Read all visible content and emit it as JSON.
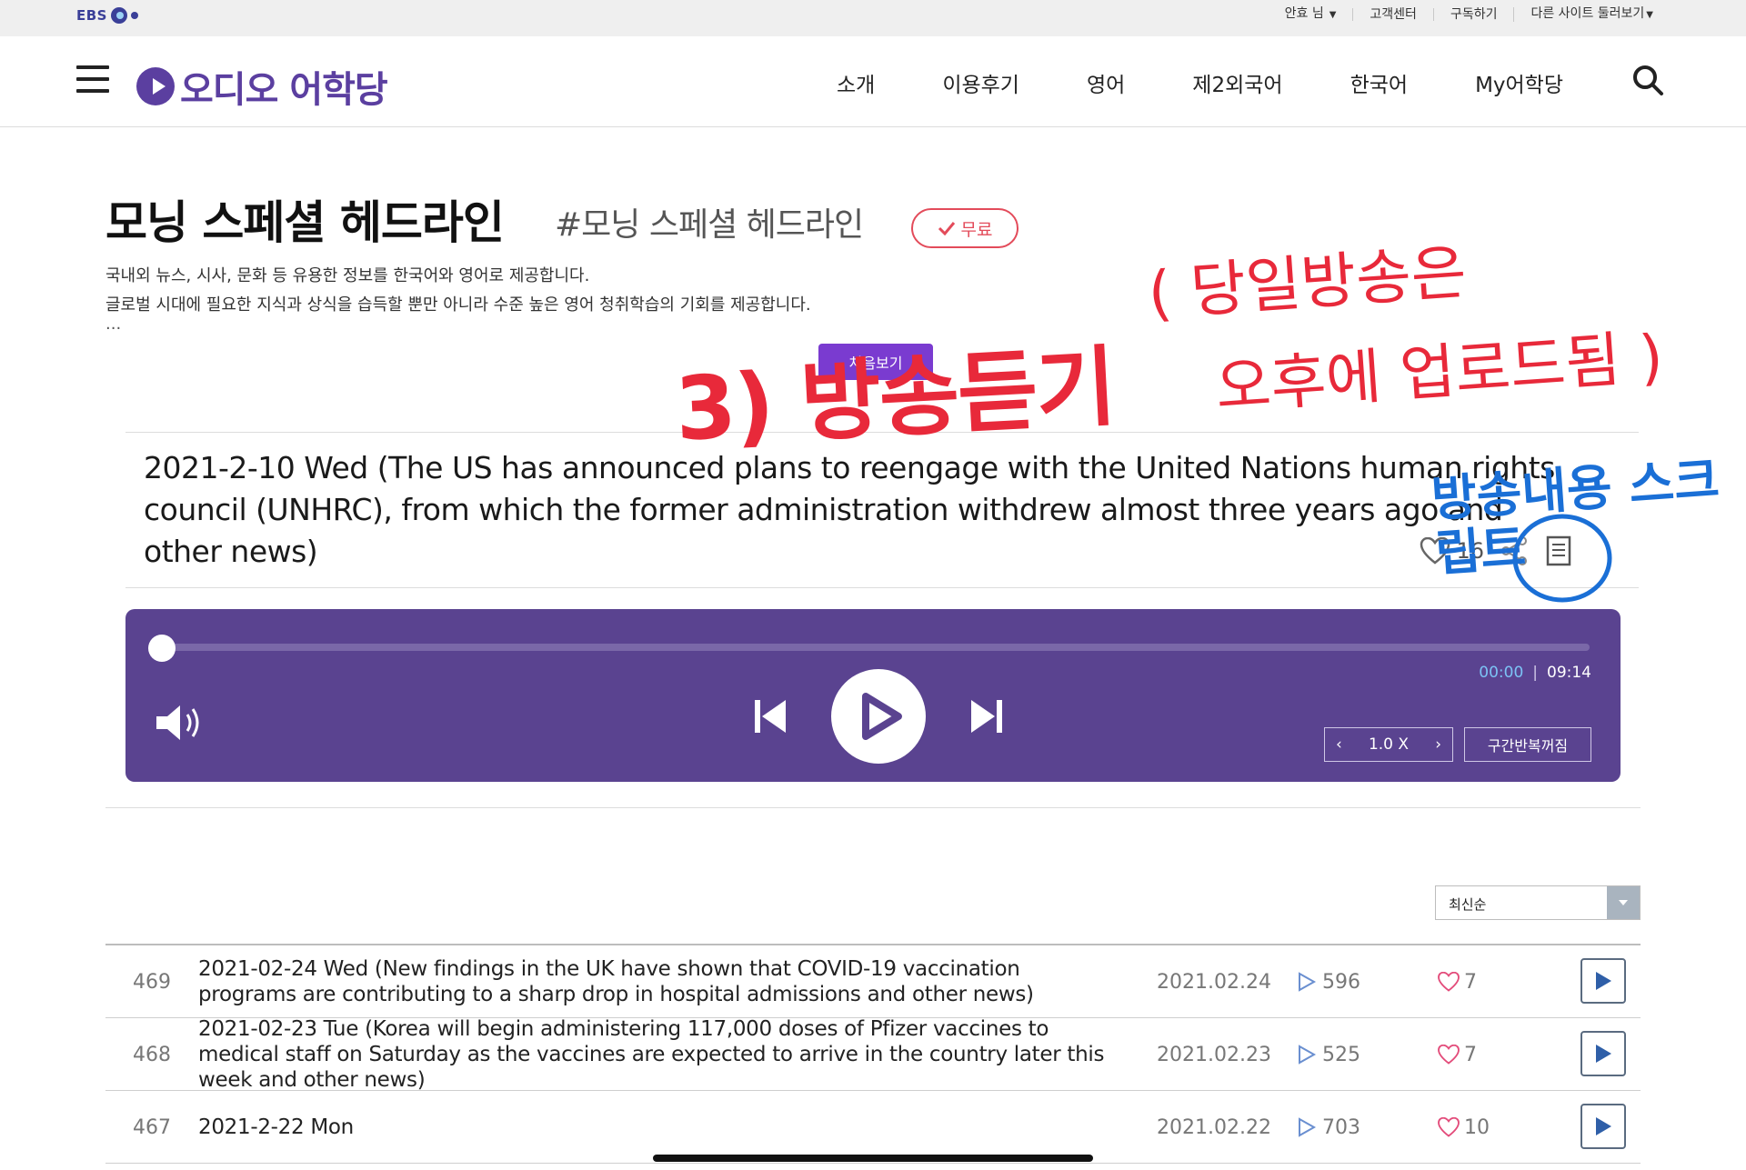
{
  "topbar": {
    "logo_text": "EBS",
    "links": [
      "안효 님",
      "고객센터",
      "구독하기",
      "다른 사이트 둘러보기"
    ]
  },
  "header": {
    "brand": "오디오 어학당",
    "nav": [
      "소개",
      "이용후기",
      "영어",
      "제2외국어",
      "한국어",
      "My어학당"
    ]
  },
  "program": {
    "title": "모닝 스페셜 헤드라인",
    "tag": "#모닝 스페셜 헤드라인",
    "badge": "무료",
    "desc_line1": "국내외 뉴스, 시사, 문화 등 유용한 정보를 한국어와 영어로 제공합니다.",
    "desc_line2": "글로벌 시대에 필요한 지식과 상식을 습득할 뿐만 아니라 수준 높은 영어 청취학습의 기회를 제공합니다.",
    "ellipsis": "...",
    "first_button": "처음보기"
  },
  "episode": {
    "title": "2021-2-10 Wed (The US has announced plans to reengage with the United Nations human rights council (UNHRC), from which the former administration withdrew almost three years ago and other news)",
    "likes": "16"
  },
  "player": {
    "progress": 0,
    "current_time": "00:00",
    "total_time": "09:14",
    "speed": "1.0 X",
    "repeat_label": "구간반복꺼짐"
  },
  "sort": {
    "selected": "최신순"
  },
  "list": [
    {
      "num": "469",
      "title": "2021-02-24 Wed (New findings in the UK have shown that COVID-19 vaccination programs are contributing to a sharp drop in hospital admissions and other news)",
      "date": "2021.02.24",
      "plays": "596",
      "likes": "7"
    },
    {
      "num": "468",
      "title": "2021-02-23 Tue (Korea will begin administering 117,000 doses of Pfizer vaccines to medical staff on Saturday as the vaccines are expected to arrive in the country later this week and other news)",
      "date": "2021.02.23",
      "plays": "525",
      "likes": "7"
    },
    {
      "num": "467",
      "title": "2021-2-22 Mon",
      "date": "2021.02.22",
      "plays": "703",
      "likes": "10"
    }
  ],
  "annotations": {
    "listen": "3) 방송듣기",
    "upload_note_1": "( 당일방송은",
    "upload_note_2": "오후에 업로드됨 )",
    "script_note": "방송내용 스크립트"
  },
  "colors": {
    "brand_purple": "#5b3fa0",
    "player_bg": "#5a4390",
    "badge_red": "#e34b5a",
    "annotation_red": "#e8293a",
    "annotation_blue": "#1a6fd6"
  }
}
